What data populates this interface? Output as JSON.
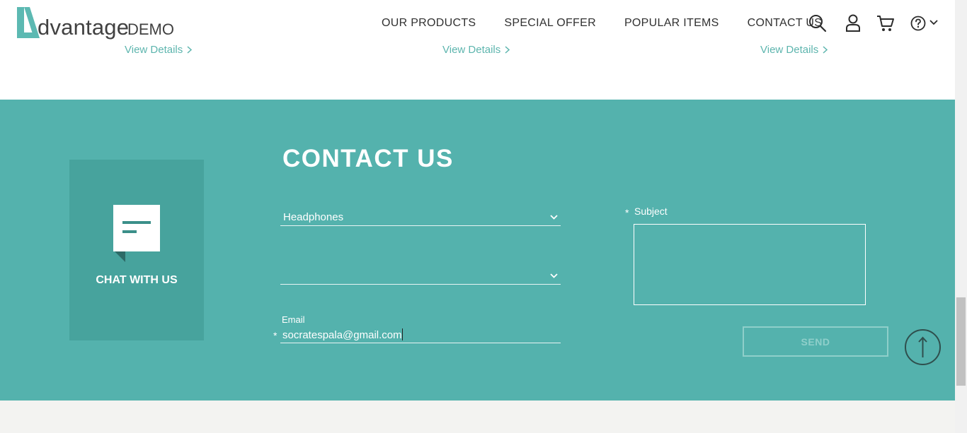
{
  "brand": {
    "logo_letter_text": "dvantage",
    "logo_demo_text": "DEMO",
    "accent_color": "#54b2ad"
  },
  "nav": {
    "items": [
      "OUR PRODUCTS",
      "SPECIAL OFFER",
      "POPULAR ITEMS",
      "CONTACT US"
    ]
  },
  "header_icons": [
    "search-icon",
    "user-icon",
    "cart-icon",
    "help-icon",
    "chevron-down-icon"
  ],
  "products": {
    "view_details": [
      "View Details",
      "View Details",
      "View Details"
    ]
  },
  "chat": {
    "label": "CHAT WITH US",
    "icon": "chat-icon"
  },
  "contact": {
    "title": "CONTACT US",
    "category_select": {
      "value": "Headphones"
    },
    "product_select": {
      "value": ""
    },
    "email": {
      "label": "Email",
      "value": "socratespala@gmail.com",
      "required_mark": "*"
    },
    "subject": {
      "label": "Subject",
      "value": "",
      "required_mark": "*"
    },
    "send_label": "SEND"
  },
  "scroll_top_icon": "arrow-up-icon"
}
